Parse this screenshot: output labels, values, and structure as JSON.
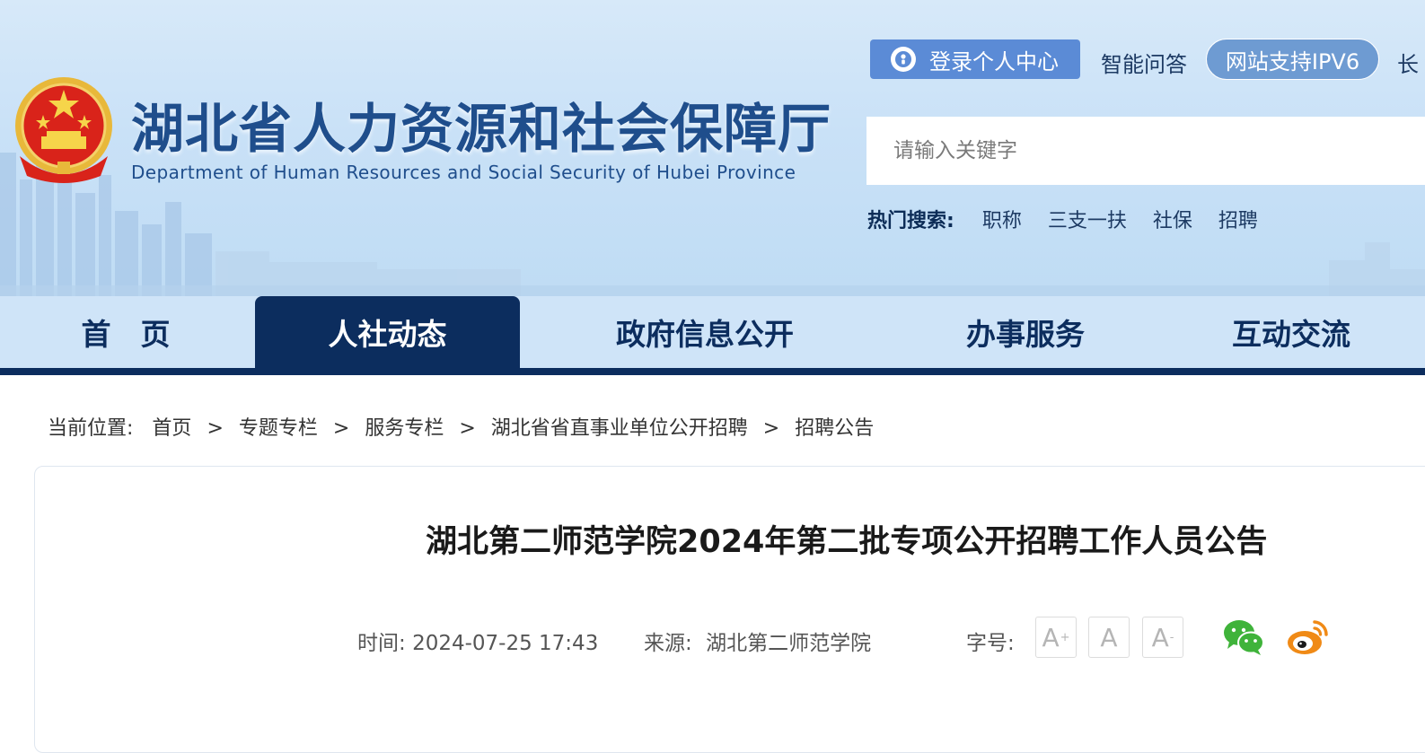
{
  "header": {
    "title": "湖北省人力资源和社会保障厅",
    "subtitle": "Department of Human Resources and Social Security of Hubei Province",
    "login_label": "登录个人中心",
    "qa_label": "智能问答",
    "ipv6_label": "网站支持IPV6",
    "cut_label": "长"
  },
  "search": {
    "placeholder": "请输入关键字",
    "hot_label": "热门搜索:",
    "hot_items": [
      "职称",
      "三支一扶",
      "社保",
      "招聘"
    ]
  },
  "nav": {
    "items": [
      "首　页",
      "人社动态",
      "政府信息公开",
      "办事服务",
      "互动交流"
    ],
    "active": "人社动态"
  },
  "breadcrumb": {
    "label": "当前位置:",
    "items": [
      "首页",
      "专题专栏",
      "服务专栏",
      "湖北省省直事业单位公开招聘",
      "招聘公告"
    ],
    "separator": ">"
  },
  "article": {
    "title": "湖北第二师范学院2024年第二批专项公开招聘工作人员公告",
    "time_label": "时间:",
    "time_value": "2024-07-25 17:43",
    "source_label": "来源:",
    "source_value": "湖北第二师范学院",
    "font_label": "字号:",
    "font_glyph": "A",
    "font_plus": "+",
    "font_minus": "-"
  },
  "colors": {
    "brand_dark": "#0c2d5e",
    "brand_blue": "#1f4e8c",
    "login_bg": "#5b8bd6",
    "wechat": "#3fb33a",
    "weibo": "#f08a16"
  },
  "icons": {
    "emblem": "national-emblem",
    "login": "user-circle-icon",
    "wechat": "wechat-icon",
    "weibo": "weibo-icon"
  }
}
